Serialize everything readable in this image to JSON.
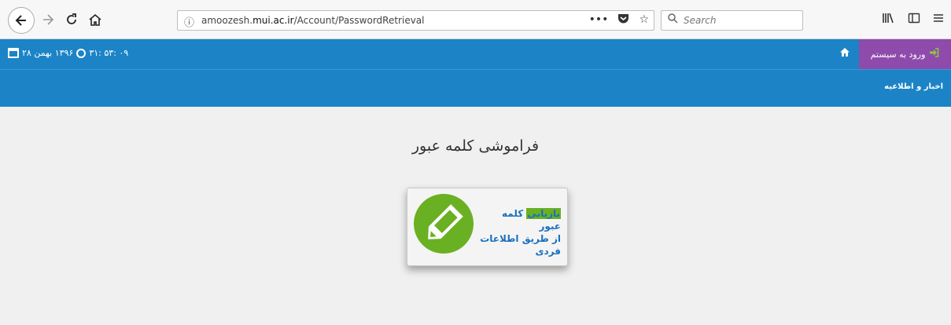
{
  "browser": {
    "url_prefix": "amoozesh.",
    "url_domain": "mui.ac.ir",
    "url_path": "/Account/PasswordRetrieval",
    "search_placeholder": "Search",
    "more_label": "•••"
  },
  "header": {
    "datetime": "۱۳۹۶ بهمن ۲۸ ۰۹ :۵۳ :۳۱",
    "date_text": "۱۳۹۶ بهمن ۲۸",
    "time_text": "۰۹ :۵۳ :۳۱",
    "login_label": "ورود به سیستم",
    "news_label": "اخبار و اطلاعیه"
  },
  "main": {
    "title": "فراموشی کلمه عبور",
    "card_highlight": "بازیابی",
    "card_text_1": " کلمه عبور",
    "card_text_2": "از طریق اطلاعات",
    "card_text_3": "فردی"
  },
  "colors": {
    "header_blue": "#1c84c6",
    "login_purple": "#8e4bac",
    "card_green": "#6ab023"
  }
}
